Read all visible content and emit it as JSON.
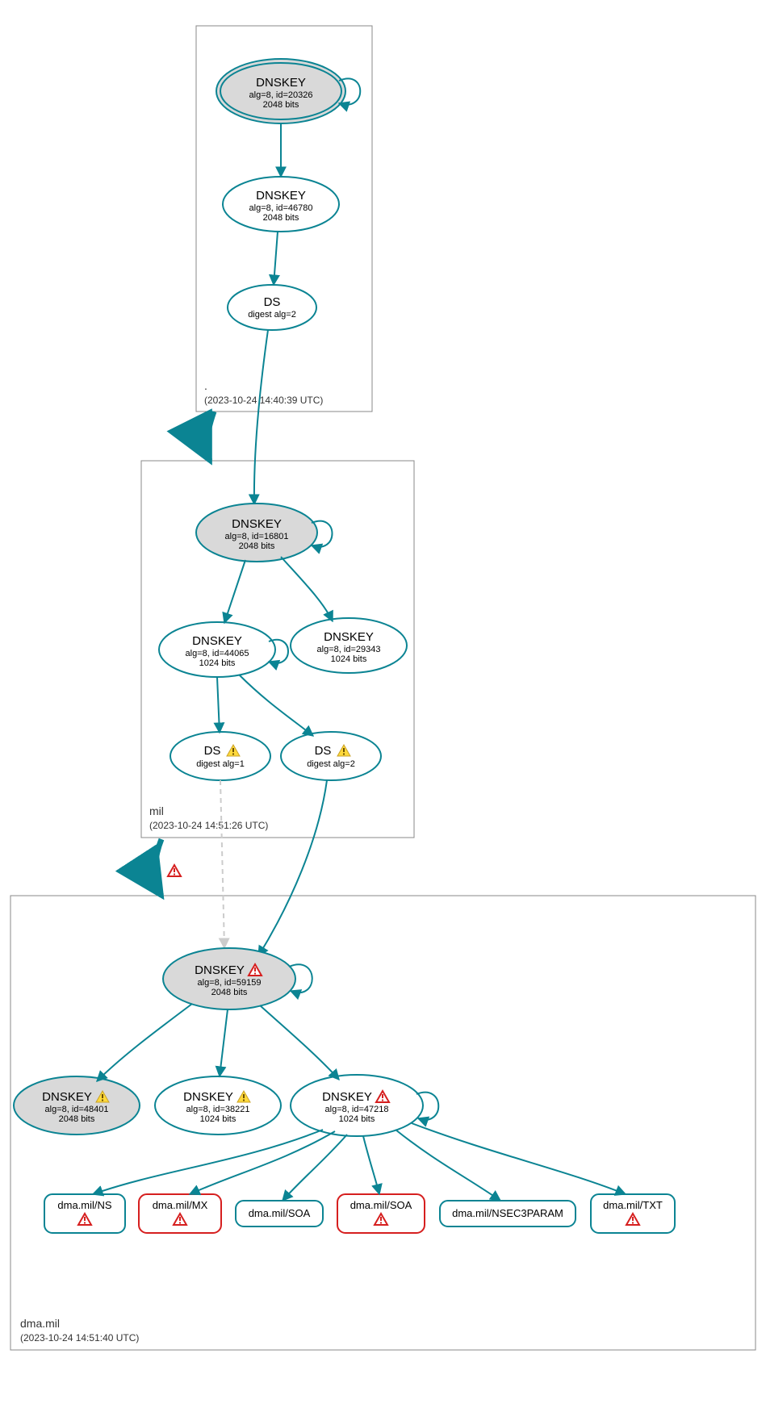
{
  "colors": {
    "teal": "#0b8493",
    "gray_fill": "#d9d9d9",
    "white": "#ffffff",
    "red": "#d61f1f",
    "box_gray": "#9a9a9a",
    "dash_gray": "#cccccc",
    "warn_yellow": "#ffd93b",
    "warn_border": "#c9a227",
    "err_fill": "#ffffff",
    "err_border": "#d61f1f"
  },
  "zones": {
    "root": {
      "label": ".",
      "timestamp": "(2023-10-24 14:40:39 UTC)"
    },
    "mil": {
      "label": "mil",
      "timestamp": "(2023-10-24 14:51:26 UTC)"
    },
    "dma": {
      "label": "dma.mil",
      "timestamp": "(2023-10-24 14:51:40 UTC)"
    }
  },
  "nodes": {
    "root_ksk": {
      "title": "DNSKEY",
      "l2": "alg=8, id=20326",
      "l3": "2048 bits"
    },
    "root_zsk": {
      "title": "DNSKEY",
      "l2": "alg=8, id=46780",
      "l3": "2048 bits"
    },
    "root_ds": {
      "title": "DS",
      "l2": "digest alg=2",
      "l3": ""
    },
    "mil_ksk": {
      "title": "DNSKEY",
      "l2": "alg=8, id=16801",
      "l3": "2048 bits"
    },
    "mil_zsk1": {
      "title": "DNSKEY",
      "l2": "alg=8, id=44065",
      "l3": "1024 bits"
    },
    "mil_zsk2": {
      "title": "DNSKEY",
      "l2": "alg=8, id=29343",
      "l3": "1024 bits"
    },
    "mil_ds1": {
      "title": "DS",
      "l2": "digest alg=1",
      "l3": ""
    },
    "mil_ds2": {
      "title": "DS",
      "l2": "digest alg=2",
      "l3": ""
    },
    "dma_ksk": {
      "title": "DNSKEY",
      "l2": "alg=8, id=59159",
      "l3": "2048 bits"
    },
    "dma_k1": {
      "title": "DNSKEY",
      "l2": "alg=8, id=48401",
      "l3": "2048 bits"
    },
    "dma_k2": {
      "title": "DNSKEY",
      "l2": "alg=8, id=38221",
      "l3": "1024 bits"
    },
    "dma_k3": {
      "title": "DNSKEY",
      "l2": "alg=8, id=47218",
      "l3": "1024 bits"
    }
  },
  "rr": {
    "ns": "dma.mil/NS",
    "mx": "dma.mil/MX",
    "soa": "dma.mil/SOA",
    "soa2": "dma.mil/SOA",
    "nsec3": "dma.mil/NSEC3PARAM",
    "txt": "dma.mil/TXT"
  }
}
